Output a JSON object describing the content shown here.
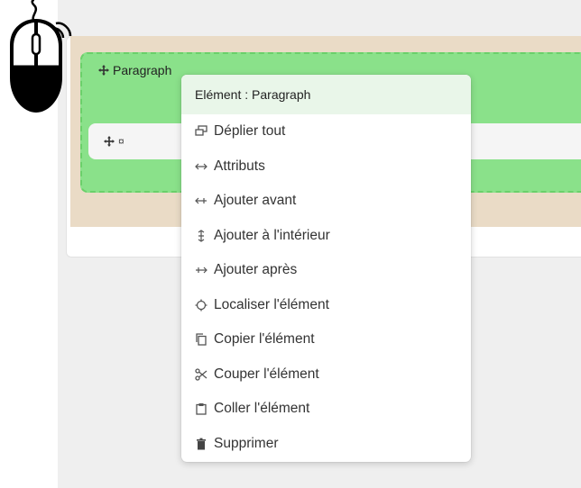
{
  "editor": {
    "block_label": "Paragraph",
    "child_label": "¤"
  },
  "context_menu": {
    "header": "Elément : Paragraph",
    "items": [
      {
        "label": "Déplier tout",
        "icon": "expand-icon"
      },
      {
        "label": "Attributs",
        "icon": "attributes-icon"
      },
      {
        "label": "Ajouter avant",
        "icon": "insert-before-icon"
      },
      {
        "label": "Ajouter à l'intérieur",
        "icon": "insert-inside-icon"
      },
      {
        "label": "Ajouter après",
        "icon": "insert-after-icon"
      },
      {
        "label": "Localiser l'élément",
        "icon": "locate-icon"
      },
      {
        "label": "Copier l'élément",
        "icon": "copy-icon"
      },
      {
        "label": "Couper l'élément",
        "icon": "cut-icon"
      },
      {
        "label": "Coller l'élément",
        "icon": "paste-icon"
      },
      {
        "label": "Supprimer",
        "icon": "trash-icon"
      }
    ]
  },
  "colors": {
    "paragraph_block": "#8ae18a",
    "tan_band": "#eadbc6",
    "menu_header": "#e9f6e9"
  },
  "overlay": {
    "icon": "mouse-right-click-icon"
  }
}
